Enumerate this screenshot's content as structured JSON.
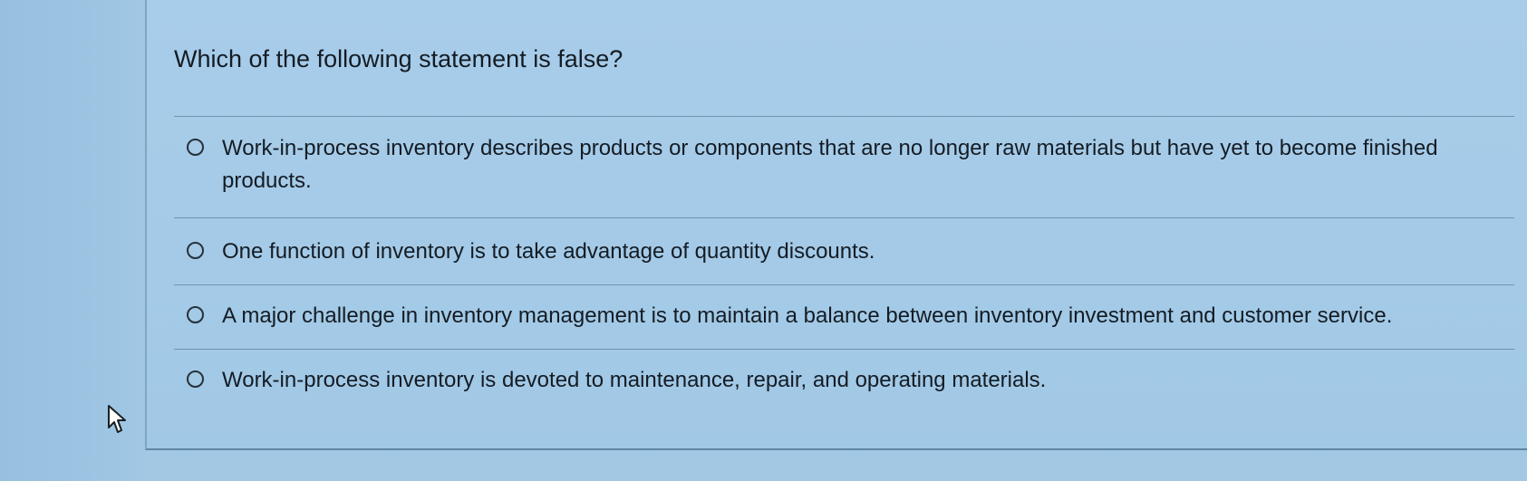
{
  "question": {
    "text": "Which of the following statement is false?"
  },
  "options": [
    {
      "label": "Work-in-process inventory describes products or components that are no longer raw materials but have yet to become finished products.",
      "selected": false
    },
    {
      "label": "One function of inventory is to take advantage of quantity discounts.",
      "selected": false
    },
    {
      "label": "A major challenge in inventory management is to maintain a balance between inventory investment and customer service.",
      "selected": false
    },
    {
      "label": "Work-in-process inventory is devoted to maintenance, repair, and operating materials.",
      "selected": false
    }
  ],
  "icons": {
    "radio": "radio-unchecked-icon",
    "cursor": "mouse-pointer-icon"
  }
}
